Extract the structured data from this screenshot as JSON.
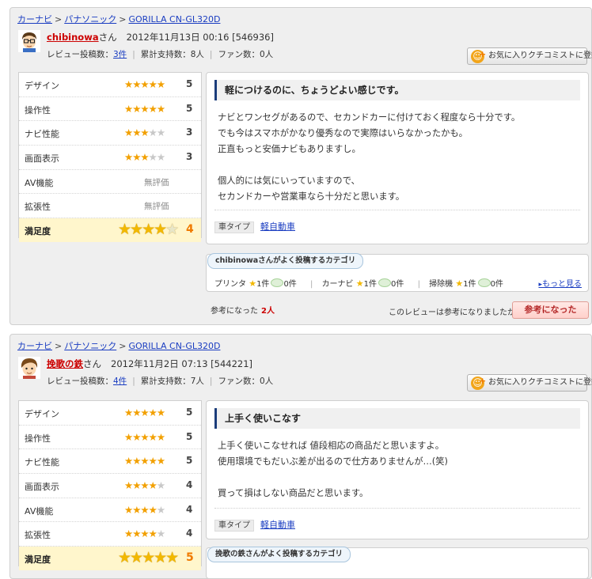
{
  "reviews": [
    {
      "breadcrumb": [
        "カーナビ",
        "パナソニック",
        "GORILLA CN-GL320D"
      ],
      "user": {
        "name": "chibinowa",
        "suffix": "さん",
        "date": "2012年11月13日 00:16",
        "id": "[546936]",
        "review_count_label": "レビュー投稿数：",
        "review_count": "3件",
        "support_label": "累計支持数：",
        "support": "8人",
        "fan_label": "ファン数：",
        "fan": "0人"
      },
      "favorite_label": "お気に入りクチコミストに登録",
      "ratings": [
        {
          "label": "デザイン",
          "stars": 5,
          "value": "5"
        },
        {
          "label": "操作性",
          "stars": 5,
          "value": "5"
        },
        {
          "label": "ナビ性能",
          "stars": 3,
          "value": "3"
        },
        {
          "label": "画面表示",
          "stars": 3,
          "value": "3"
        },
        {
          "label": "AV機能",
          "stars": 0,
          "value": "無評価"
        },
        {
          "label": "拡張性",
          "stars": 0,
          "value": "無評価"
        }
      ],
      "satisfaction": {
        "label": "満足度",
        "stars": 4,
        "value": "4"
      },
      "title": "軽につけるのに、ちょうどよい感じです。",
      "body": [
        "ナビとワンセグがあるので、セカンドカーに付けておく程度なら十分です。",
        "でも今はスマホがかなり優秀なので実際はいらなかったかも。",
        "正直もっと安価ナビもありますし。",
        "",
        "個人的には気にいっていますので、",
        "セカンドカーや営業車なら十分だと思います。"
      ],
      "car_type_label": "車タイプ",
      "car_type": "軽自動車",
      "category_label": "chibinowaさんがよく投稿するカテゴリ",
      "categories": [
        {
          "name": "プリンタ",
          "good": "1件",
          "bad": "0件"
        },
        {
          "name": "カーナビ",
          "good": "1件",
          "bad": "0件"
        },
        {
          "name": "掃除機",
          "good": "1件",
          "bad": "0件"
        }
      ],
      "more_label": "もっと見る",
      "helpful_label": "参考になった",
      "helpful_count": "2人",
      "helpful_question": "このレビューは参考になりましたか？",
      "helpful_button": "参考になった"
    },
    {
      "breadcrumb": [
        "カーナビ",
        "パナソニック",
        "GORILLA CN-GL320D"
      ],
      "user": {
        "name": "挽歌の鉄",
        "suffix": "さん",
        "date": "2012年11月2日 07:13",
        "id": "[544221]",
        "review_count_label": "レビュー投稿数：",
        "review_count": "4件",
        "support_label": "累計支持数：",
        "support": "7人",
        "fan_label": "ファン数：",
        "fan": "0人"
      },
      "favorite_label": "お気に入りクチコミストに登録",
      "ratings": [
        {
          "label": "デザイン",
          "stars": 5,
          "value": "5"
        },
        {
          "label": "操作性",
          "stars": 5,
          "value": "5"
        },
        {
          "label": "ナビ性能",
          "stars": 5,
          "value": "5"
        },
        {
          "label": "画面表示",
          "stars": 4,
          "value": "4"
        },
        {
          "label": "AV機能",
          "stars": 4,
          "value": "4"
        },
        {
          "label": "拡張性",
          "stars": 4,
          "value": "4"
        }
      ],
      "satisfaction": {
        "label": "満足度",
        "stars": 5,
        "value": "5"
      },
      "title": "上手く使いこなす",
      "body": [
        "上手く使いこなせれば 値段相応の商品だと思いますよ。",
        "使用環境でもだいぶ差が出るので仕方ありませんが…(笑)",
        "",
        "買って損はしない商品だと思います。"
      ],
      "car_type_label": "車タイプ",
      "car_type": "軽自動車",
      "category_label": "挽歌の鉄さんがよく投稿するカテゴリ"
    }
  ],
  "colors": {
    "accent": "#1a3c7a",
    "link": "#1a3dc1",
    "username": "#cc0000",
    "star": "#f2a000"
  }
}
